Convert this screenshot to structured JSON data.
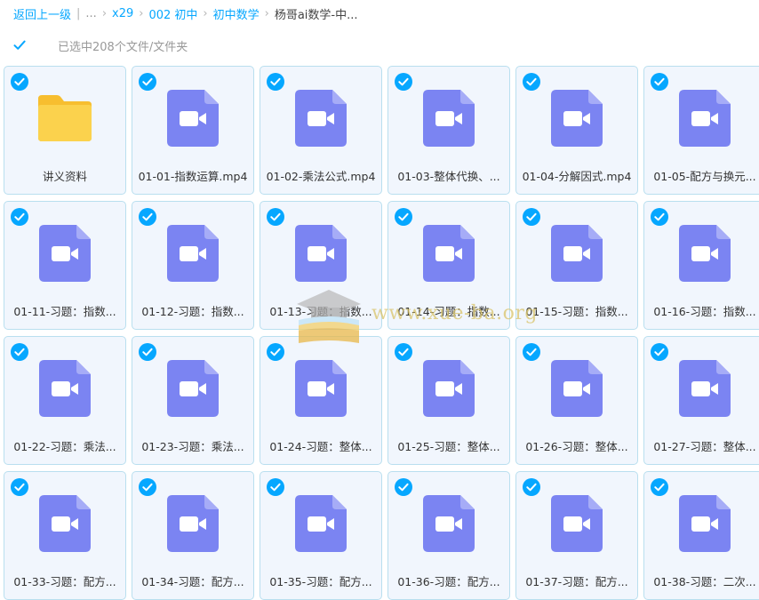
{
  "breadcrumb": {
    "back": "返回上一级",
    "sep": "|",
    "ellipsis": "...",
    "items": [
      "x29",
      "002 初中",
      "初中数学"
    ],
    "current": "杨哥ai数学-中..."
  },
  "selection": {
    "text": "已选中208个文件/文件夹"
  },
  "colors": {
    "accent": "#06a7ff",
    "video_icon": "#7b84f2",
    "folder": "#fbd24d",
    "tile_bg": "#f1f6fd",
    "tile_border": "#b9dfef"
  },
  "files": [
    {
      "name": "讲义资料",
      "type": "folder"
    },
    {
      "name": "01-01-指数运算.mp4",
      "type": "video"
    },
    {
      "name": "01-02-乘法公式.mp4",
      "type": "video"
    },
    {
      "name": "01-03-整体代换、...",
      "type": "video"
    },
    {
      "name": "01-04-分解因式.mp4",
      "type": "video"
    },
    {
      "name": "01-05-配方与换元...",
      "type": "video"
    },
    {
      "name": "01-11-习题：指数...",
      "type": "video"
    },
    {
      "name": "01-12-习题：指数...",
      "type": "video"
    },
    {
      "name": "01-13-习题：指数...",
      "type": "video"
    },
    {
      "name": "01-14-习题：指数...",
      "type": "video"
    },
    {
      "name": "01-15-习题：指数...",
      "type": "video"
    },
    {
      "name": "01-16-习题：指数...",
      "type": "video"
    },
    {
      "name": "01-22-习题：乘法...",
      "type": "video"
    },
    {
      "name": "01-23-习题：乘法...",
      "type": "video"
    },
    {
      "name": "01-24-习题：整体...",
      "type": "video"
    },
    {
      "name": "01-25-习题：整体...",
      "type": "video"
    },
    {
      "name": "01-26-习题：整体...",
      "type": "video"
    },
    {
      "name": "01-27-习题：整体...",
      "type": "video"
    },
    {
      "name": "01-33-习题：配方...",
      "type": "video"
    },
    {
      "name": "01-34-习题：配方...",
      "type": "video"
    },
    {
      "name": "01-35-习题：配方...",
      "type": "video"
    },
    {
      "name": "01-36-习题：配方...",
      "type": "video"
    },
    {
      "name": "01-37-习题：配方...",
      "type": "video"
    },
    {
      "name": "01-38-习题：二次...",
      "type": "video"
    }
  ],
  "watermark": {
    "text": "www.xue-ba.org"
  }
}
